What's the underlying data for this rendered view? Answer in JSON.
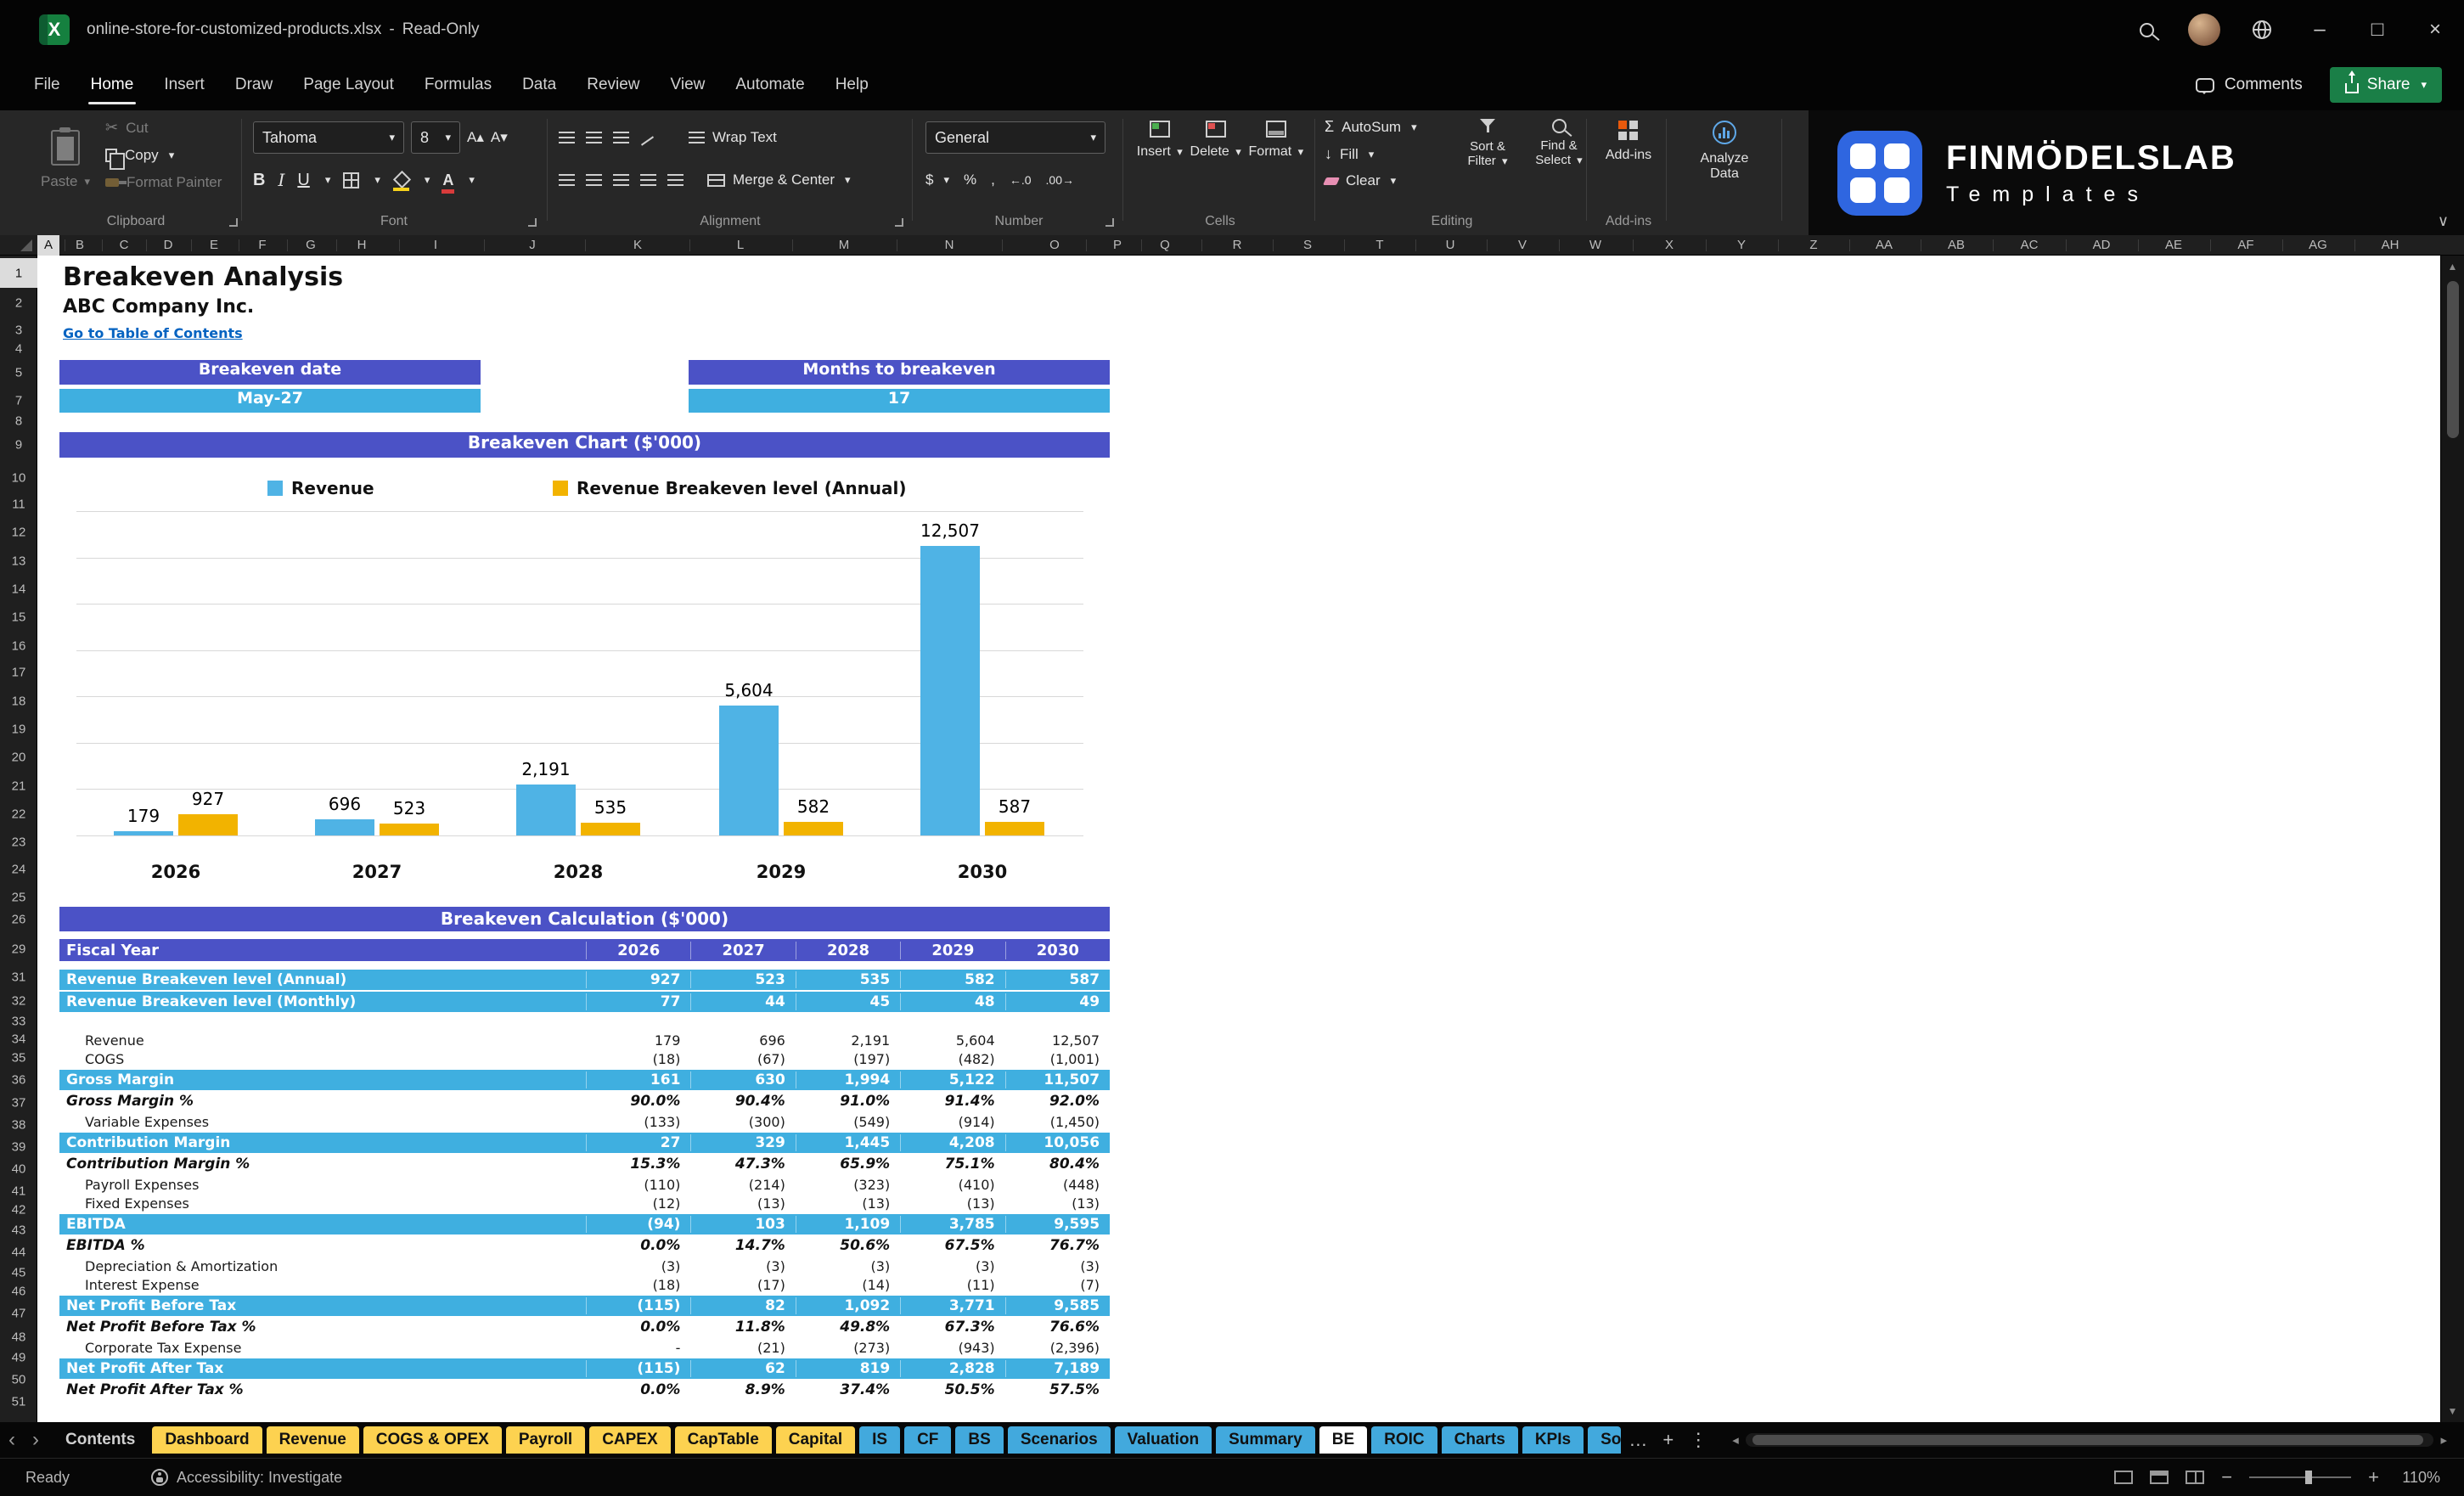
{
  "window": {
    "file_name": "online-store-for-customized-products.xlsx",
    "separator": "-",
    "mode": "Read-Only"
  },
  "menu": {
    "tabs": [
      "File",
      "Home",
      "Insert",
      "Draw",
      "Page Layout",
      "Formulas",
      "Data",
      "Review",
      "View",
      "Automate",
      "Help"
    ],
    "active_tab": "Home",
    "comments_label": "Comments",
    "share_label": "Share"
  },
  "ribbon": {
    "clipboard": {
      "label": "Clipboard",
      "paste": "Paste",
      "cut": "Cut",
      "copy": "Copy",
      "format_painter": "Format Painter"
    },
    "font": {
      "label": "Font",
      "font_name": "Tahoma",
      "font_size": "8",
      "bold": "B",
      "italic": "I",
      "underline": "U"
    },
    "alignment": {
      "label": "Alignment",
      "wrap_text": "Wrap Text",
      "merge_center": "Merge & Center"
    },
    "number": {
      "label": "Number",
      "format": "General"
    },
    "cells": {
      "label": "Cells",
      "insert": "Insert",
      "delete": "Delete",
      "format": "Format"
    },
    "editing": {
      "label": "Editing",
      "autosum": "AutoSum",
      "fill": "Fill",
      "clear": "Clear",
      "sort_filter": "Sort & Filter",
      "find_select": "Find & Select"
    },
    "addins": {
      "label": "Add-ins",
      "button": "Add-ins"
    },
    "analyze": {
      "label": "Analyze Data"
    },
    "logo": {
      "brand": "FINMÖDELSLAB",
      "sub": "Templates"
    }
  },
  "icons": {
    "dropdown": "▾",
    "scissors": "✂",
    "autosum": "Σ",
    "currency": "$",
    "percent": "%",
    "comma": ",",
    "increase_decimal": "←.0",
    "decrease_decimal": ".00→",
    "fill_arrow": "↓",
    "excel_x": "X",
    "minimize": "–",
    "restore": "□",
    "close": "×",
    "chevron_left": "‹",
    "chevron_right": "›",
    "more": "…",
    "add_sheet": "+",
    "divider_dots": "⋮",
    "scroll_left": "◂",
    "scroll_right": "▸",
    "scroll_up": "▲",
    "scroll_down": "▼",
    "zoom_out": "−",
    "zoom_in": "+",
    "collapse": "∨",
    "font_grow": "A▴",
    "font_shrink": "A▾"
  },
  "grid": {
    "columns": [
      "A",
      "B",
      "C",
      "D",
      "E",
      "F",
      "G",
      "H",
      "I",
      "J",
      "K",
      "L",
      "M",
      "N",
      "O",
      "P",
      "Q",
      "R",
      "S",
      "T",
      "U",
      "V",
      "W",
      "X",
      "Y",
      "Z",
      "AA",
      "AB",
      "AC",
      "AD",
      "AE",
      "AF",
      "AG",
      "AH"
    ],
    "rows": [
      1,
      2,
      3,
      4,
      5,
      7,
      8,
      9,
      10,
      11,
      12,
      13,
      14,
      15,
      16,
      17,
      18,
      19,
      20,
      21,
      22,
      23,
      24,
      25,
      26,
      29,
      31,
      32,
      33,
      34,
      35,
      36,
      37,
      38,
      39,
      40,
      41,
      42,
      43,
      44,
      45,
      46,
      47,
      48,
      49,
      50,
      51
    ]
  },
  "sheet": {
    "title": "Breakeven Analysis",
    "company": "ABC Company Inc.",
    "link": "Go to Table of Contents",
    "info_boxes": [
      {
        "header": "Breakeven date",
        "value": "May-27"
      },
      {
        "header": "Months to breakeven",
        "value": "17"
      }
    ],
    "chart_header": "Breakeven Chart ($'000)",
    "calc_header": "Breakeven Calculation ($'000)",
    "table": {
      "header": [
        "Fiscal Year",
        "2026",
        "2027",
        "2028",
        "2029",
        "2030"
      ],
      "rows": [
        {
          "label": "Revenue Breakeven level (Annual)",
          "style": "highlight",
          "values": [
            "927",
            "523",
            "535",
            "582",
            "587"
          ]
        },
        {
          "label": "Revenue Breakeven level (Monthly)",
          "style": "highlight",
          "values": [
            "77",
            "44",
            "45",
            "48",
            "49"
          ]
        },
        {
          "label": "",
          "style": "spacer",
          "values": []
        },
        {
          "label": "Revenue",
          "style": "plain",
          "values": [
            "179",
            "696",
            "2,191",
            "5,604",
            "12,507"
          ]
        },
        {
          "label": "COGS",
          "style": "plain",
          "values": [
            "(18)",
            "(67)",
            "(197)",
            "(482)",
            "(1,001)"
          ]
        },
        {
          "label": "Gross Margin",
          "style": "total",
          "values": [
            "161",
            "630",
            "1,994",
            "5,122",
            "11,507"
          ]
        },
        {
          "label": "Gross Margin %",
          "style": "pct",
          "values": [
            "90.0%",
            "90.4%",
            "91.0%",
            "91.4%",
            "92.0%"
          ]
        },
        {
          "label": "Variable Expenses",
          "style": "plain",
          "values": [
            "(133)",
            "(300)",
            "(549)",
            "(914)",
            "(1,450)"
          ]
        },
        {
          "label": "Contribution Margin",
          "style": "total",
          "values": [
            "27",
            "329",
            "1,445",
            "4,208",
            "10,056"
          ]
        },
        {
          "label": "Contribution Margin %",
          "style": "pct",
          "values": [
            "15.3%",
            "47.3%",
            "65.9%",
            "75.1%",
            "80.4%"
          ]
        },
        {
          "label": "Payroll Expenses",
          "style": "plain",
          "values": [
            "(110)",
            "(214)",
            "(323)",
            "(410)",
            "(448)"
          ]
        },
        {
          "label": "Fixed Expenses",
          "style": "plain",
          "values": [
            "(12)",
            "(13)",
            "(13)",
            "(13)",
            "(13)"
          ]
        },
        {
          "label": "EBITDA",
          "style": "total",
          "values": [
            "(94)",
            "103",
            "1,109",
            "3,785",
            "9,595"
          ]
        },
        {
          "label": "EBITDA %",
          "style": "pct",
          "values": [
            "0.0%",
            "14.7%",
            "50.6%",
            "67.5%",
            "76.7%"
          ]
        },
        {
          "label": "Depreciation & Amortization",
          "style": "plain",
          "values": [
            "(3)",
            "(3)",
            "(3)",
            "(3)",
            "(3)"
          ]
        },
        {
          "label": "Interest Expense",
          "style": "plain",
          "values": [
            "(18)",
            "(17)",
            "(14)",
            "(11)",
            "(7)"
          ]
        },
        {
          "label": "Net Profit Before Tax",
          "style": "total",
          "values": [
            "(115)",
            "82",
            "1,092",
            "3,771",
            "9,585"
          ]
        },
        {
          "label": "Net Profit Before Tax %",
          "style": "pct",
          "values": [
            "0.0%",
            "11.8%",
            "49.8%",
            "67.3%",
            "76.6%"
          ]
        },
        {
          "label": "Corporate Tax Expense",
          "style": "plain",
          "values": [
            "-",
            "(21)",
            "(273)",
            "(943)",
            "(2,396)"
          ]
        },
        {
          "label": "Net Profit After Tax",
          "style": "total",
          "values": [
            "(115)",
            "62",
            "819",
            "2,828",
            "7,189"
          ]
        },
        {
          "label": "Net Profit After Tax %",
          "style": "pct",
          "values": [
            "0.0%",
            "8.9%",
            "37.4%",
            "50.5%",
            "57.5%"
          ]
        }
      ]
    }
  },
  "chart_data": {
    "type": "bar",
    "title": "Breakeven Chart ($'000)",
    "categories": [
      "2026",
      "2027",
      "2028",
      "2029",
      "2030"
    ],
    "series": [
      {
        "name": "Revenue",
        "color": "#4fb3e5",
        "values": [
          179,
          696,
          2191,
          5604,
          12507
        ],
        "labels": [
          "179",
          "696",
          "2,191",
          "5,604",
          "12,507"
        ]
      },
      {
        "name": "Revenue Breakeven level (Annual)",
        "color": "#f2b300",
        "values": [
          927,
          523,
          535,
          582,
          587
        ],
        "labels": [
          "927",
          "523",
          "535",
          "582",
          "587"
        ]
      }
    ],
    "xlabel": "",
    "ylabel": "",
    "ylim": [
      0,
      14000
    ],
    "gridlines": 7,
    "grid": true,
    "legend_position": "top"
  },
  "tabs_bar": {
    "tabs": [
      {
        "label": "Contents",
        "style": "plain"
      },
      {
        "label": "Dashboard",
        "style": "yellow"
      },
      {
        "label": "Revenue",
        "style": "yellow"
      },
      {
        "label": "COGS & OPEX",
        "style": "yellow"
      },
      {
        "label": "Payroll",
        "style": "yellow"
      },
      {
        "label": "CAPEX",
        "style": "yellow"
      },
      {
        "label": "CapTable",
        "style": "yellow"
      },
      {
        "label": "Capital",
        "style": "yellow"
      },
      {
        "label": "IS",
        "style": "blue"
      },
      {
        "label": "CF",
        "style": "blue"
      },
      {
        "label": "BS",
        "style": "blue"
      },
      {
        "label": "Scenarios",
        "style": "blue"
      },
      {
        "label": "Valuation",
        "style": "blue"
      },
      {
        "label": "Summary",
        "style": "blue"
      },
      {
        "label": "BE",
        "style": "active"
      },
      {
        "label": "ROIC",
        "style": "blue"
      },
      {
        "label": "Charts",
        "style": "blue"
      },
      {
        "label": "KPIs",
        "style": "blue"
      },
      {
        "label": "So",
        "style": "blue",
        "clipped": true
      }
    ]
  },
  "status_bar": {
    "ready": "Ready",
    "accessibility": "Accessibility: Investigate",
    "zoom": "110%"
  },
  "colors": {
    "purple_header": "#4b52c6",
    "light_blue": "#3fafe0",
    "bar_blue": "#4fb3e5",
    "bar_yellow": "#f2b300",
    "tab_yellow": "#fdd250",
    "tab_blue": "#42a9dd",
    "link": "#0563c1",
    "share_green": "#1a7f47",
    "excel_green": "#15803f",
    "logo_blue": "#2f66e0"
  }
}
